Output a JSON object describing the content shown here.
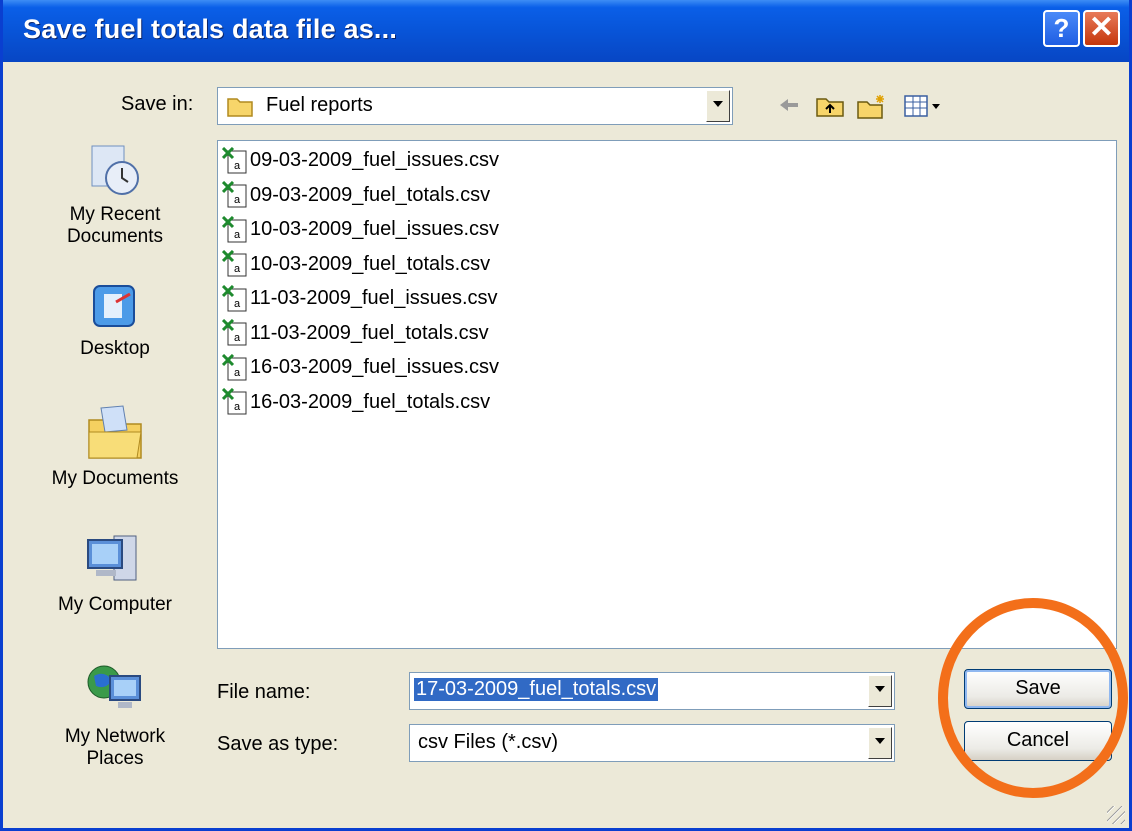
{
  "window": {
    "title": "Save fuel totals data file as...",
    "help_label": "?",
    "close_label": "✕"
  },
  "toolbar": {
    "save_in_label": "Save in:",
    "save_in_value": "Fuel reports",
    "icons": [
      "back-arrow-icon",
      "up-folder-icon",
      "new-folder-icon",
      "view-menu-icon"
    ]
  },
  "places": [
    {
      "label": "My Recent Documents",
      "icon": "recent-documents-icon"
    },
    {
      "label": "Desktop",
      "icon": "desktop-icon"
    },
    {
      "label": "My Documents",
      "icon": "my-documents-icon"
    },
    {
      "label": "My Computer",
      "icon": "my-computer-icon"
    },
    {
      "label": "My Network Places",
      "icon": "network-places-icon"
    }
  ],
  "files": [
    "09-03-2009_fuel_issues.csv",
    "09-03-2009_fuel_totals.csv",
    "10-03-2009_fuel_issues.csv",
    "10-03-2009_fuel_totals.csv",
    "11-03-2009_fuel_issues.csv",
    "11-03-2009_fuel_totals.csv",
    "16-03-2009_fuel_issues.csv",
    "16-03-2009_fuel_totals.csv"
  ],
  "form": {
    "file_name_label": "File name:",
    "file_name_value": "17-03-2009_fuel_totals.csv",
    "save_type_label": "Save as type:",
    "save_type_value": "csv Files (*.csv)"
  },
  "buttons": {
    "save": "Save",
    "cancel": "Cancel"
  },
  "colors": {
    "titlebar": "#0853d6",
    "highlight_circle": "#f36f1a",
    "selection": "#316ac5"
  }
}
